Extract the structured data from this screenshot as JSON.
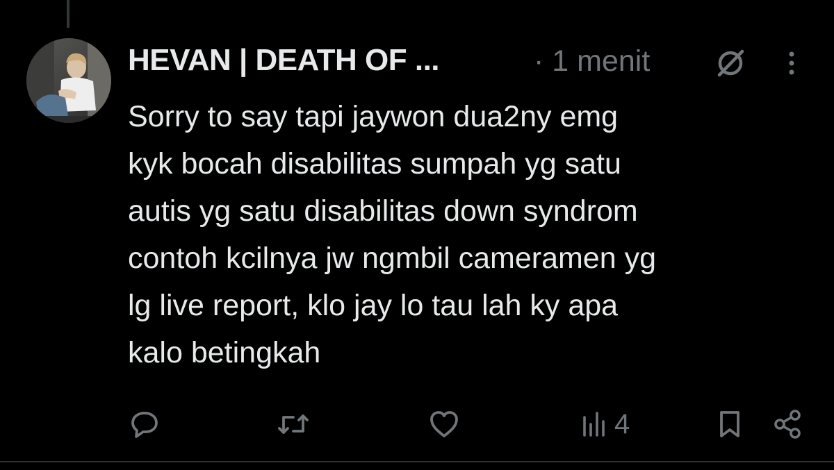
{
  "post": {
    "author_name": "HEVAN | DEATH OF ...",
    "separator": "·",
    "timestamp": "1 menit",
    "text_lines": [
      "Sorry to say tapi jaywon dua2ny emg",
      "kyk bocah disabilitas sumpah yg satu",
      "autis yg satu disabilitas down syndrom",
      "contoh kcilnya jw ngmbil cameramen yg",
      "lg live report, klo jay lo tau lah ky apa",
      "kalo betingkah"
    ]
  },
  "actions": {
    "reply_icon": "reply-icon",
    "retweet_icon": "retweet-icon",
    "like_icon": "heart-icon",
    "views_icon": "views-chart-icon",
    "views_count": "4",
    "bookmark_icon": "bookmark-icon",
    "share_icon": "share-icon"
  },
  "header_icons": {
    "grok": "grok-icon",
    "more": "more-vertical-icon"
  },
  "colors": {
    "background": "#000000",
    "primary_text": "#e7e9ea",
    "secondary_text": "#71767b",
    "divider": "#2f3336"
  }
}
